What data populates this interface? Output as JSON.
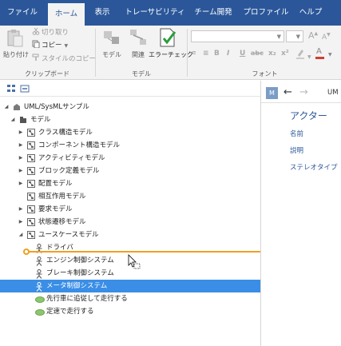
{
  "menu": {
    "items": [
      {
        "label": "ファイル",
        "name": "menu-file",
        "active": false
      },
      {
        "label": "ホーム",
        "name": "menu-home",
        "active": true
      },
      {
        "label": "表示",
        "name": "menu-view",
        "active": false
      },
      {
        "label": "トレーサビリティ",
        "name": "menu-traceability",
        "active": false
      },
      {
        "label": "チーム開発",
        "name": "menu-team-dev",
        "active": false
      },
      {
        "label": "プロファイル",
        "name": "menu-profile",
        "active": false
      },
      {
        "label": "ヘルプ",
        "name": "menu-help",
        "active": false
      }
    ]
  },
  "ribbon": {
    "clipboard": {
      "paste": "貼り付け",
      "cut": "切り取り",
      "copy": "コピー",
      "style_copy": "スタイルのコピー",
      "group_label": "クリップボード"
    },
    "model": {
      "model": "モデル",
      "relation": "関連",
      "error_check": "エラーチェック",
      "group_label": "モデル"
    },
    "font": {
      "group_label": "フォント",
      "grow": "A",
      "shrink": "A",
      "bold": "B",
      "italic": "I",
      "underline": "U",
      "strike": "abc",
      "subscript": "x₂",
      "superscript": "x²",
      "font_color": "A"
    }
  },
  "tree": {
    "rows": [
      {
        "label": "UML/SysMLサンプル",
        "expander": "◢",
        "icon": "project-icon",
        "color": "#7a7a7a"
      },
      {
        "label": "モデル",
        "expander": "◢",
        "icon": "model-folder-icon",
        "color": "#555555"
      },
      {
        "label": "クラス構造モデル",
        "expander": "▶",
        "icon": "class-diagram-icon",
        "color": "#666666"
      },
      {
        "label": "コンポーネント構造モデル",
        "expander": "▶",
        "icon": "component-diagram-icon",
        "color": "#666666"
      },
      {
        "label": "アクティビティモデル",
        "expander": "▶",
        "icon": "activity-diagram-icon",
        "color": "#666666"
      },
      {
        "label": "ブロック定義モデル",
        "expander": "▶",
        "icon": "block-diagram-icon",
        "color": "#666666"
      },
      {
        "label": "配置モデル",
        "expander": "▶",
        "icon": "deployment-diagram-icon",
        "color": "#666666"
      },
      {
        "label": "相互作用モデル",
        "expander": "",
        "icon": "interaction-diagram-icon",
        "color": "#666666"
      },
      {
        "label": "要求モデル",
        "expander": "▶",
        "icon": "requirement-diagram-icon",
        "color": "#666666"
      },
      {
        "label": "状態遷移モデル",
        "expander": "▶",
        "icon": "state-diagram-icon",
        "color": "#666666"
      },
      {
        "label": "ユースケースモデル",
        "expander": "◢",
        "icon": "usecase-diagram-icon",
        "color": "#666666"
      },
      {
        "label": "ドライバ",
        "expander": "",
        "icon": "actor-icon",
        "color": "#555555"
      },
      {
        "label": "エンジン制御システム",
        "expander": "",
        "icon": "actor-icon",
        "color": "#555555"
      },
      {
        "label": "ブレーキ制御システム",
        "expander": "",
        "icon": "actor-icon",
        "color": "#555555"
      },
      {
        "label": "メータ制御システム",
        "expander": "",
        "icon": "actor-icon",
        "color": "#ffffff",
        "selected": true
      },
      {
        "label": "先行車に追従して走行する",
        "expander": "",
        "icon": "usecase-icon",
        "color": "#8cc66e"
      },
      {
        "label": "定速で走行する",
        "expander": "",
        "icon": "usecase-icon",
        "color": "#8cc66e"
      }
    ]
  },
  "right_pane": {
    "badge": "M",
    "back_arrow": "←",
    "forward_arrow": "→",
    "path": "UM",
    "title": "アクター",
    "fields": [
      "名前",
      "説明",
      "ステレオタイプ"
    ]
  },
  "colors": {
    "menubar": "#2b579a",
    "selection": "#3a8ee6",
    "drop_indicator": "#f0a020",
    "link": "#2b579a"
  }
}
